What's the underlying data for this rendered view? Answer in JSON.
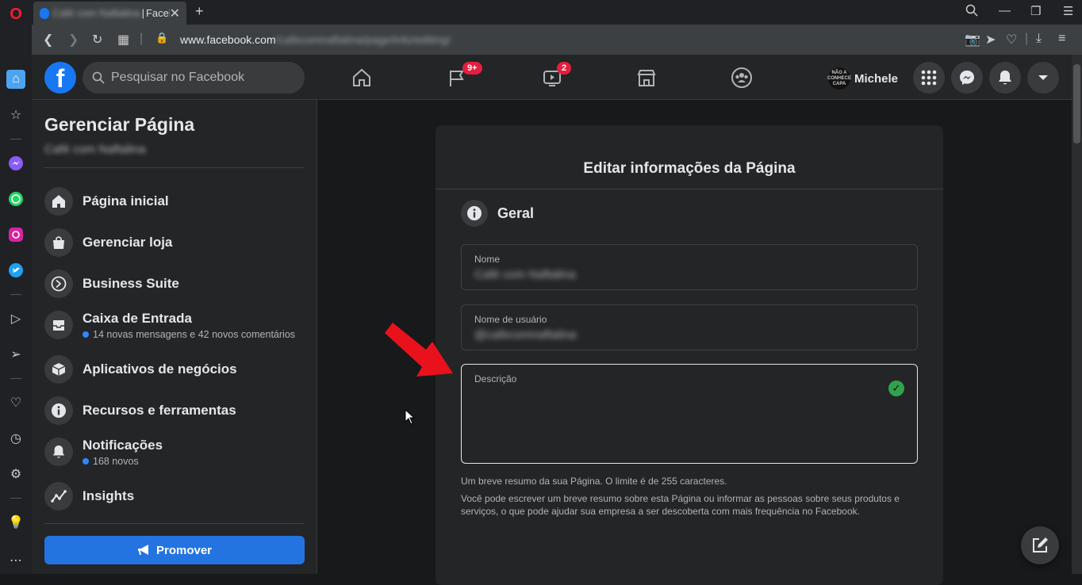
{
  "browser": {
    "tab_title_blurred": "Café com Naftalina",
    "tab_title": "Facebook",
    "url_host": "www.facebook.com",
    "url_path_blurred": "/cafecomnaftalina/page/info/editing/"
  },
  "header": {
    "search_placeholder": "Pesquisar no Facebook",
    "pages_badge": "9+",
    "watch_badge": "2",
    "profile_name": "Michele",
    "avatar_text": "NÃO A CONHECE CAPA"
  },
  "sidebar": {
    "title": "Gerenciar Página",
    "page_name_blurred": "Café com Naftalina",
    "items": [
      {
        "label": "Página inicial",
        "icon": "home-icon"
      },
      {
        "label": "Gerenciar loja",
        "icon": "shopping-bag-icon"
      },
      {
        "label": "Business Suite",
        "icon": "business-suite-icon"
      },
      {
        "label": "Caixa de Entrada",
        "meta": "14 novas mensagens e 42 novos comentários",
        "icon": "inbox-icon"
      },
      {
        "label": "Aplicativos de negócios",
        "icon": "cube-icon"
      },
      {
        "label": "Recursos e ferramentas",
        "icon": "info-icon"
      },
      {
        "label": "Notificações",
        "meta": "168 novos",
        "icon": "bell-icon"
      },
      {
        "label": "Insights",
        "icon": "insights-icon"
      }
    ],
    "promote_label": "Promover"
  },
  "card": {
    "title": "Editar informações da Página",
    "section": "Geral",
    "name_label": "Nome",
    "name_value_blurred": "Café com Naftalina",
    "username_label": "Nome de usuário",
    "username_value_blurred": "@cafecomnaftalina",
    "description_label": "Descrição",
    "help1": "Um breve resumo da sua Página. O limite é de 255 caracteres.",
    "help2": "Você pode escrever um breve resumo sobre esta Página ou informar as pessoas sobre seus produtos e serviços, o que pode ajudar sua empresa a ser descoberta com mais frequência no Facebook."
  },
  "colors": {
    "accent": "#1877f2",
    "badge": "#e41e3f",
    "check": "#31a24c",
    "arrow": "#e8111c"
  }
}
